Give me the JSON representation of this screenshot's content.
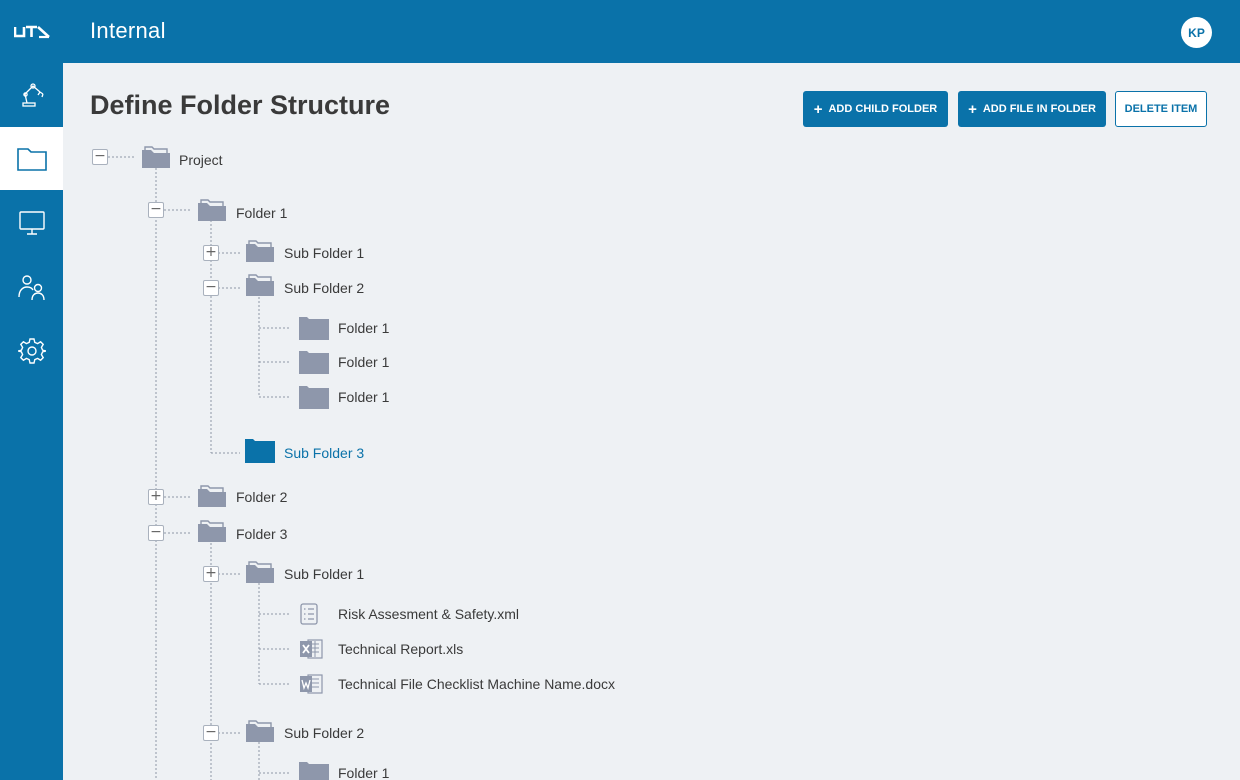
{
  "app": {
    "title": "Internal",
    "user_initials": "KP"
  },
  "colors": {
    "brand": "#0a72a9",
    "folder": "#8e97ab",
    "selected": "#0a72a9"
  },
  "sidebar": {
    "items": [
      {
        "name": "robot-arm-icon",
        "active": false
      },
      {
        "name": "folder-icon",
        "active": true
      },
      {
        "name": "monitor-icon",
        "active": false
      },
      {
        "name": "users-icon",
        "active": false
      },
      {
        "name": "gear-icon",
        "active": false
      }
    ]
  },
  "page": {
    "title": "Define Folder Structure"
  },
  "toolbar": {
    "add_child_folder": "ADD CHILD FOLDER",
    "add_file_in_folder": "ADD FILE IN FOLDER",
    "delete_item": "DELETE ITEM"
  },
  "tree": [
    {
      "label": "Project",
      "type": "folder-open",
      "toggle": "−"
    },
    {
      "label": "Folder 1",
      "type": "folder-open",
      "toggle": "−"
    },
    {
      "label": "Sub Folder 1",
      "type": "folder-open",
      "toggle": "+"
    },
    {
      "label": "Sub Folder 2",
      "type": "folder-open",
      "toggle": "−"
    },
    {
      "label": "Folder 1",
      "type": "folder-closed",
      "toggle": null
    },
    {
      "label": "Folder 1",
      "type": "folder-closed",
      "toggle": null
    },
    {
      "label": "Folder 1",
      "type": "folder-closed",
      "toggle": null
    },
    {
      "label": "Sub Folder 3",
      "type": "folder-closed",
      "toggle": null,
      "selected": true
    },
    {
      "label": "Folder 2",
      "type": "folder-open",
      "toggle": "+"
    },
    {
      "label": "Folder 3",
      "type": "folder-open",
      "toggle": "−"
    },
    {
      "label": "Sub Folder 1",
      "type": "folder-open",
      "toggle": "+"
    },
    {
      "label": "Risk Assesment & Safety.xml",
      "type": "file-xml",
      "toggle": null
    },
    {
      "label": "Technical Report.xls",
      "type": "file-excel",
      "toggle": null
    },
    {
      "label": "Technical File Checklist Machine Name.docx",
      "type": "file-word",
      "toggle": null
    },
    {
      "label": "Sub Folder 2",
      "type": "folder-open",
      "toggle": "−"
    },
    {
      "label": "Folder 1",
      "type": "folder-closed",
      "toggle": null
    }
  ]
}
